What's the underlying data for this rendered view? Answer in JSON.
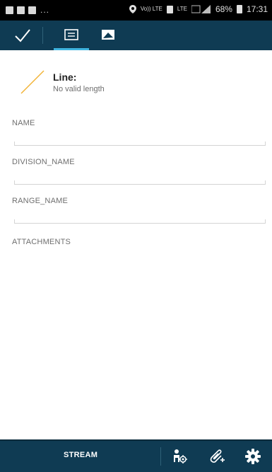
{
  "status_bar": {
    "left_dots": "...",
    "network_label_1": "Vo)) LTE",
    "network_label_2": "LTE",
    "battery": "68%",
    "time": "17:31"
  },
  "toolbar": {
    "active_tab": "form"
  },
  "feature": {
    "title": "Line:",
    "subtitle": "No valid length"
  },
  "fields": [
    {
      "label": "NAME",
      "value": ""
    },
    {
      "label": "DIVISION_NAME",
      "value": ""
    },
    {
      "label": "RANGE_NAME",
      "value": ""
    }
  ],
  "attachments_label": "ATTACHMENTS",
  "bottom_bar": {
    "stream_label": "STREAM"
  },
  "colors": {
    "bar_bg": "#0f3b53",
    "accent": "#3fb4df",
    "line_icon": "#f2b233"
  }
}
